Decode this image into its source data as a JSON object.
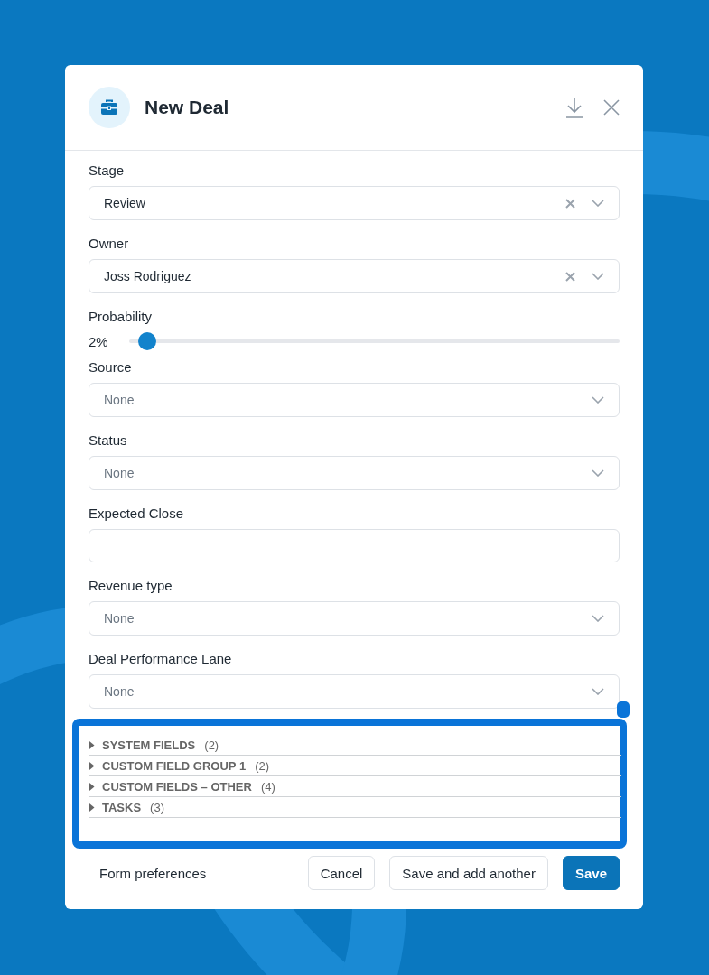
{
  "dialog": {
    "title": "New Deal"
  },
  "fields": [
    {
      "kind": "select",
      "label": "Stage",
      "value": "Review",
      "clearable": true
    },
    {
      "kind": "select",
      "label": "Owner",
      "value": "Joss Rodriguez",
      "clearable": true
    },
    {
      "kind": "slider",
      "label": "Probability",
      "reading": "2%",
      "level": 0.02
    },
    {
      "kind": "select",
      "label": "Source",
      "placeholder": "None",
      "clearable": false
    },
    {
      "kind": "select",
      "label": "Status",
      "placeholder": "None",
      "clearable": false
    },
    {
      "kind": "text",
      "label": "Expected Close"
    },
    {
      "kind": "select",
      "label": "Revenue type",
      "placeholder": "None",
      "clearable": false
    },
    {
      "kind": "select",
      "label": "Deal Performance Lane",
      "placeholder": "None",
      "clearable": false
    }
  ],
  "sections": [
    {
      "title": "SYSTEM FIELDS",
      "count": "(2)",
      "expanded": false
    },
    {
      "title": "CUSTOM FIELD GROUP 1",
      "count": "(2)",
      "expanded": false
    },
    {
      "title": "CUSTOM FIELDS – OTHER",
      "count": "(4)",
      "expanded": false
    },
    {
      "title": "TASKS",
      "count": "(3)",
      "expanded": false
    }
  ],
  "footer": {
    "link": "Form preferences",
    "buttons": [
      {
        "label": "Cancel",
        "kind": "secondary"
      },
      {
        "label": "Save and add another",
        "kind": "secondary"
      },
      {
        "label": "Save",
        "kind": "primary"
      }
    ]
  }
}
